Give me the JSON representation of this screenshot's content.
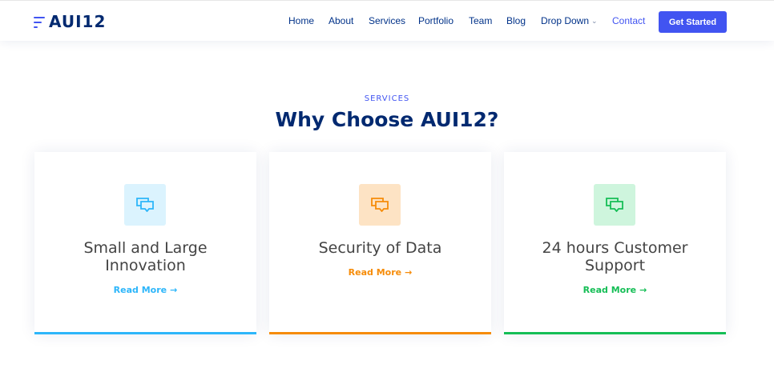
{
  "header": {
    "logo_text": "AUI12",
    "nav": [
      {
        "label": "Home"
      },
      {
        "label": "About"
      },
      {
        "label": "Services"
      },
      {
        "label": "Portfolio"
      },
      {
        "label": "Team"
      },
      {
        "label": "Blog"
      },
      {
        "label": "Drop Down"
      },
      {
        "label": "Contact"
      }
    ],
    "cta_label": "Get Started",
    "colors": {
      "brand": "#4154f1",
      "nav_text": "#013289"
    }
  },
  "section": {
    "eyebrow": "SERVICES",
    "title": "Why Choose AUI12?"
  },
  "cards": [
    {
      "title": "Small and Large Innovation",
      "link": "Read More",
      "icon": "chat-bubbles-icon",
      "accent": "#2db6fa"
    },
    {
      "title": "Security of Data",
      "link": "Read More",
      "icon": "chat-bubbles-icon",
      "accent": "#f68c09"
    },
    {
      "title": "24 hours Customer Support",
      "link": "Read More",
      "icon": "chat-bubbles-icon",
      "accent": "#15be56"
    }
  ]
}
